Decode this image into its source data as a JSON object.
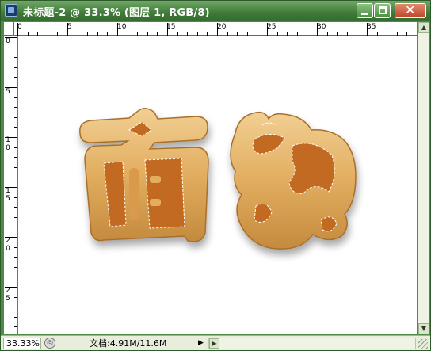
{
  "window": {
    "title": "未标题-2 @ 33.3% (图层 1, RGB/8)",
    "accent": "#4f8a47",
    "controls": {
      "minimize": "minimize-icon",
      "maximize": "maximize-icon",
      "close": "close-icon"
    }
  },
  "rulers": {
    "horizontal": [
      "0",
      "5",
      "10",
      "15",
      "20",
      "25",
      "30",
      "35"
    ],
    "vertical": [
      [
        "0"
      ],
      [
        "5"
      ],
      [
        "1",
        "0"
      ],
      [
        "1",
        "5"
      ],
      [
        "2",
        "0"
      ],
      [
        "2",
        "5"
      ]
    ]
  },
  "canvas": {
    "text": "面包",
    "style": "bread-crust text with active marching-ants selection",
    "colors": {
      "crust": "#e0a95a",
      "inner": "#b8621d",
      "background": "#ffffff"
    }
  },
  "statusbar": {
    "zoom": "33.33%",
    "doc_size": "文档:4.91M/11.6M"
  }
}
